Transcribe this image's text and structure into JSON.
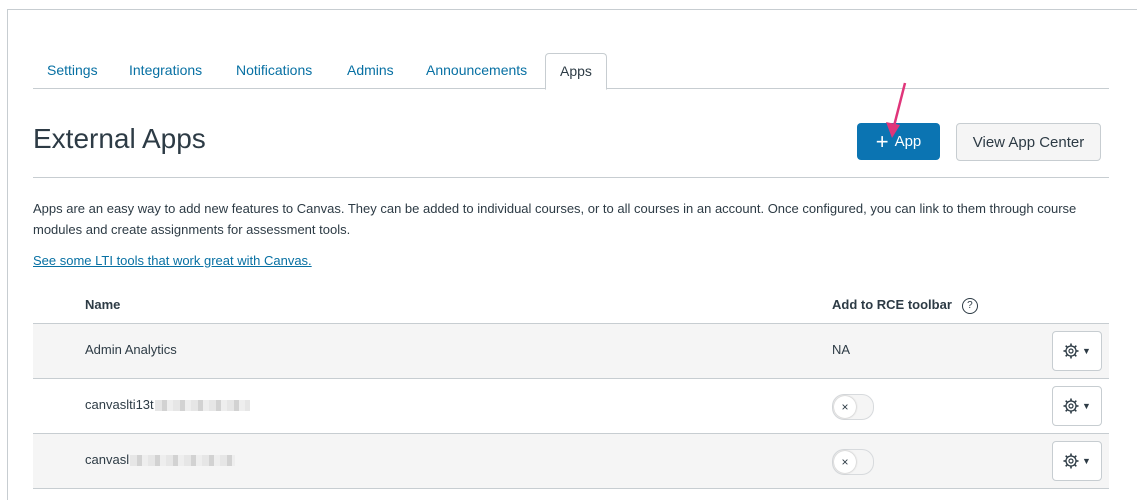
{
  "tabs": [
    {
      "label": "Settings"
    },
    {
      "label": "Integrations"
    },
    {
      "label": "Notifications"
    },
    {
      "label": "Admins"
    },
    {
      "label": "Announcements"
    },
    {
      "label": "Apps"
    }
  ],
  "active_tab": "Apps",
  "header": {
    "title": "External Apps",
    "add_app_plus": "+",
    "add_app_label": "App",
    "view_center_label": "View App Center"
  },
  "description": "Apps are an easy way to add new features to Canvas. They can be added to individual courses, or to all courses in an account. Once configured, you can link to them through course modules and create assignments for assessment tools.",
  "lti_link": "See some LTI tools that work great with Canvas.",
  "table": {
    "col_name": "Name",
    "col_rce": "Add to RCE toolbar",
    "help_glyph": "?",
    "rows": [
      {
        "name": "Admin Analytics",
        "rce": "NA",
        "toggle": null
      },
      {
        "name": "canvaslti13t",
        "rce": "",
        "toggle": "off",
        "toggle_glyph": "×"
      },
      {
        "name": "canvasl",
        "rce": "",
        "toggle": "off",
        "toggle_glyph": "×"
      }
    ]
  },
  "colors": {
    "primary": "#0b74b2",
    "link": "#0770a3",
    "annotation_arrow": "#e0357a"
  },
  "icons": {
    "settings": "gear-icon",
    "caret": "caret-down-icon",
    "toggle": "x-icon"
  }
}
